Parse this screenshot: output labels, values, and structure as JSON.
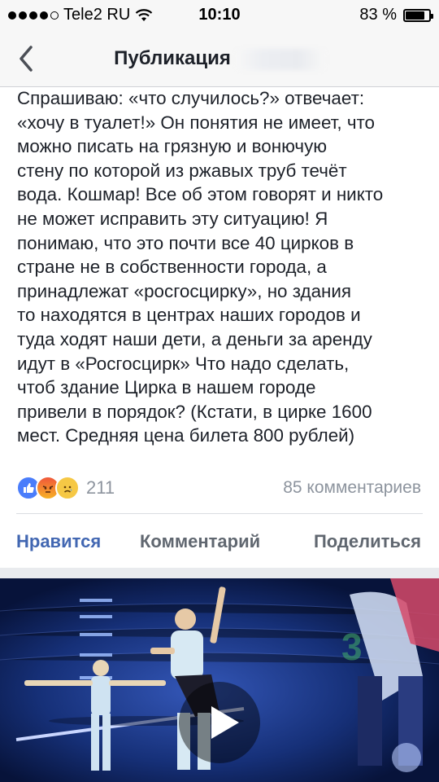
{
  "status_bar": {
    "carrier": "Tele2 RU",
    "time": "10:10",
    "battery_percent": "83 %",
    "battery_level": 0.83,
    "signal_icon": "signal-dots-icon",
    "wifi_icon": "wifi-icon"
  },
  "nav": {
    "back_icon": "chevron-left-icon",
    "title": "Публикация"
  },
  "post": {
    "text": "Спрашиваю: «что случилось?» отвечает:\n«хочу в туалет!» Он понятия не имеет, что\nможно писать на грязную и вонючую\nстену по которой из ржавых труб течёт\nвода. Кошмар! Все об этом говорят и никто\nне может исправить эту ситуацию! Я\nпонимаю, что это почти все 40 цирков в\nстране не в собственности города, а\nпринадлежат «росгосцирку»,  но здания\nто находятся в центрах наших городов и\nтуда ходят наши дети, а деньги за аренду\nидут в «Росгосцирк» Что надо сделать,\nчтоб здание Цирка в нашем городе\nпривели в порядок? (Кстати, в цирке 1600\nмест. Средняя цена билета 800 рублей)",
    "reactions": {
      "icons": [
        "like-icon",
        "angry-icon",
        "sad-icon"
      ],
      "count": "211"
    },
    "comments_count": "85 комментариев"
  },
  "actions": {
    "like": "Нравится",
    "comment": "Комментарий",
    "share": "Поделиться"
  },
  "video": {
    "play_icon": "play-icon"
  },
  "colors": {
    "accent": "#4267b2",
    "muted": "#8d949e"
  }
}
